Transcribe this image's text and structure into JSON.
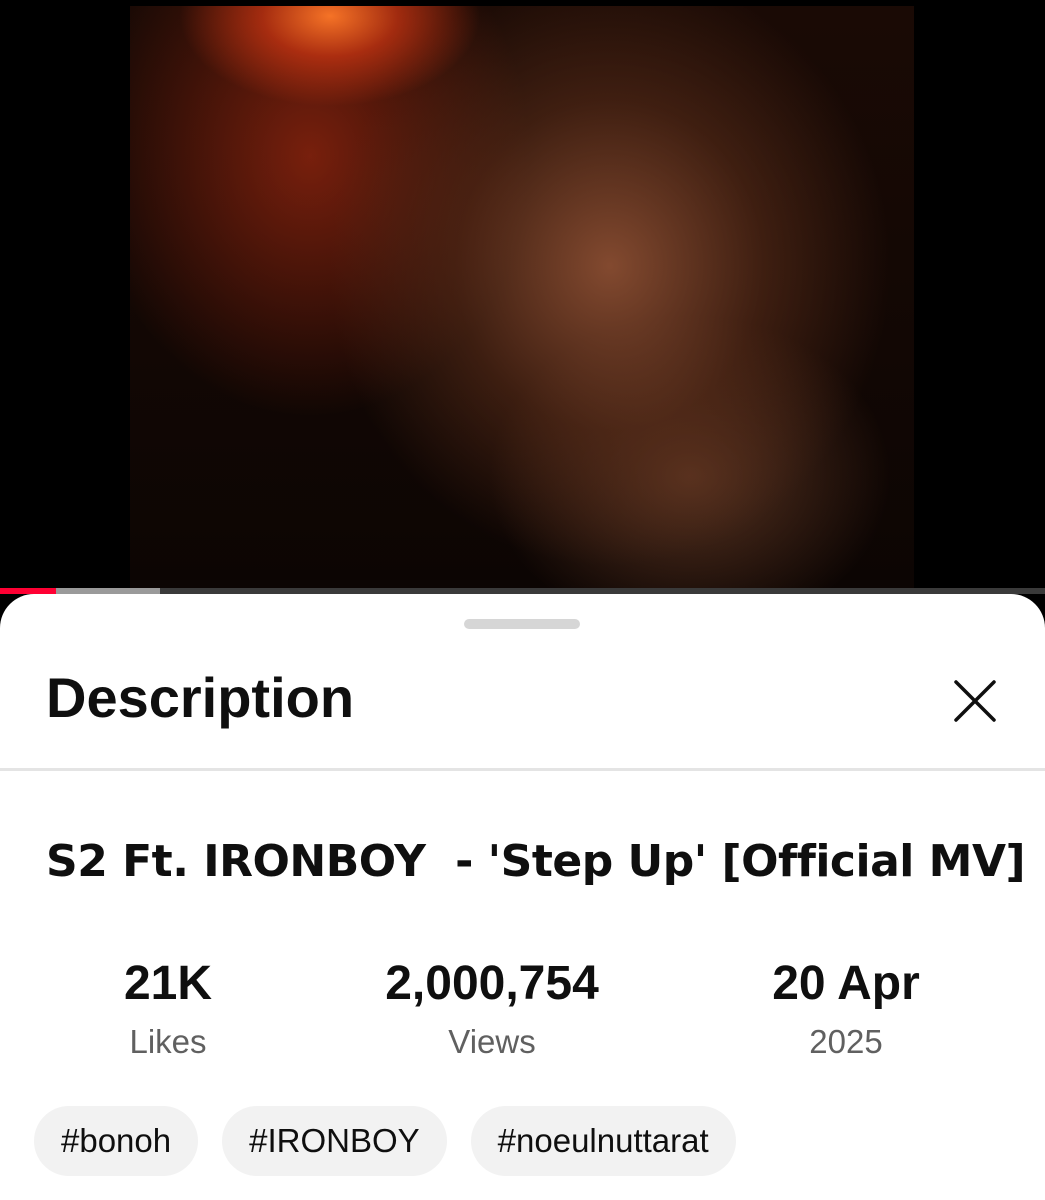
{
  "video": {
    "progress_played": 0.054,
    "progress_buffered": 0.153
  },
  "sheet": {
    "title": "Description",
    "close_icon": "close-icon"
  },
  "video_info": {
    "title": "S2 Ft. IRONBOY  - 'Step Up' [Official MV]",
    "stats": [
      {
        "value": "21K",
        "label": "Likes"
      },
      {
        "value": "2,000,754",
        "label": "Views"
      },
      {
        "value": "20 Apr",
        "label": "2025"
      }
    ],
    "hashtags": [
      "#bonoh",
      "#IRONBOY",
      "#noeulnuttarat"
    ]
  },
  "colors": {
    "progress_played": "#ff0033",
    "chip_background": "#f2f2f2"
  }
}
